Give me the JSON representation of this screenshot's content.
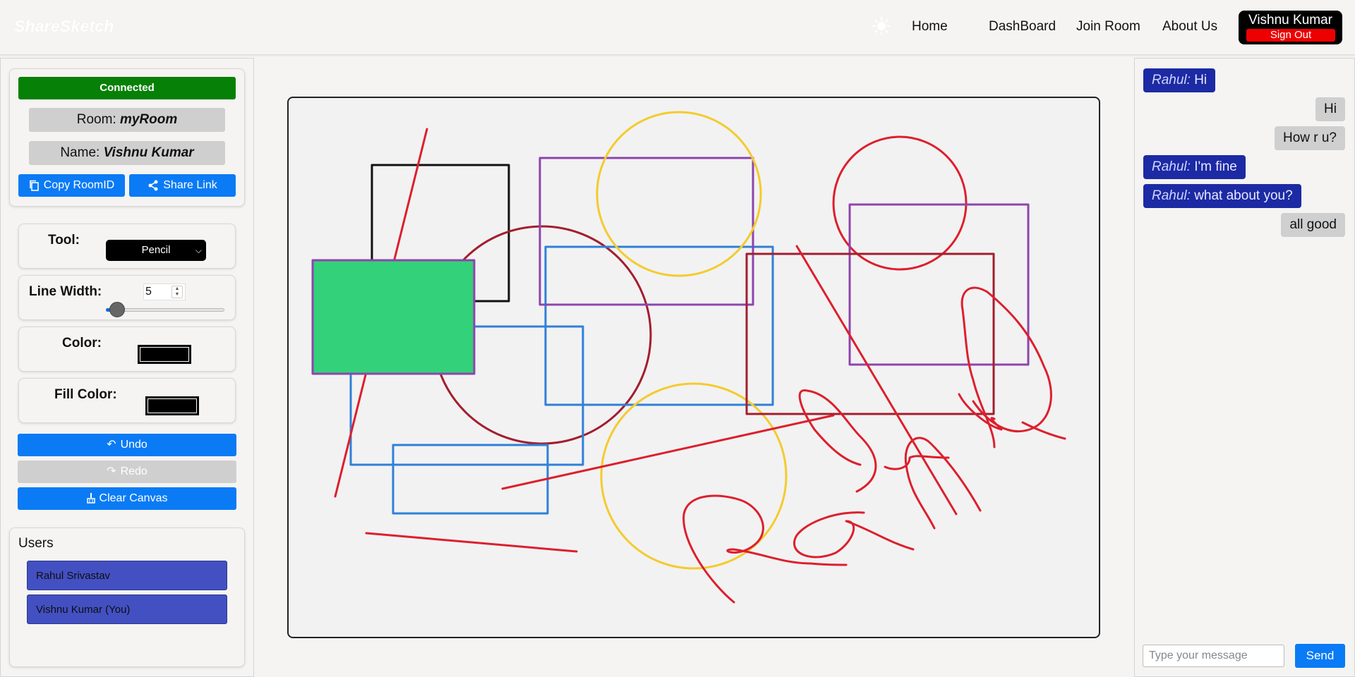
{
  "navbar": {
    "brand": "ShareSketch",
    "theme_icon": "sun-icon",
    "links": [
      "Home",
      "DashBoard",
      "Join Room",
      "About Us"
    ],
    "user_name": "Vishnu Kumar",
    "sign_out": "Sign Out"
  },
  "sidebar": {
    "status": "Connected",
    "room_label": "Room:",
    "room_value": "myRoom",
    "name_label": "Name:",
    "name_value": "Vishnu Kumar",
    "copy_room_id": "Copy RoomID",
    "share_link": "Share Link",
    "tool_label": "Tool:",
    "tool_value": "Pencil",
    "line_width_label": "Line Width:",
    "line_width_value": "5",
    "line_width_slider_value": 5,
    "color_label": "Color:",
    "color_value": "#000000",
    "fill_color_label": "Fill Color:",
    "fill_color_value": "#000000",
    "undo": "Undo",
    "redo": "Redo",
    "clear_canvas": "Clear Canvas",
    "users_title": "Users",
    "users": [
      "Rahul Srivastav",
      "Vishnu Kumar (You)"
    ]
  },
  "colors": {
    "accent_blue": "#0a7bf5",
    "connected_green": "#078007",
    "sign_out_red": "#ee0000",
    "user_item": "#4350c2",
    "chat_other": "#1c2aa4"
  },
  "chat": {
    "messages": [
      {
        "from": "Rahul:",
        "text": "Hi",
        "mine": false
      },
      {
        "from": "",
        "text": "Hi",
        "mine": true
      },
      {
        "from": "",
        "text": "How r u?",
        "mine": true
      },
      {
        "from": "Rahul:",
        "text": "I'm fine",
        "mine": false
      },
      {
        "from": "Rahul:",
        "text": "what about you?",
        "mine": false
      },
      {
        "from": "",
        "text": "all good",
        "mine": true
      }
    ],
    "input_placeholder": "Type your message",
    "send": "Send"
  }
}
